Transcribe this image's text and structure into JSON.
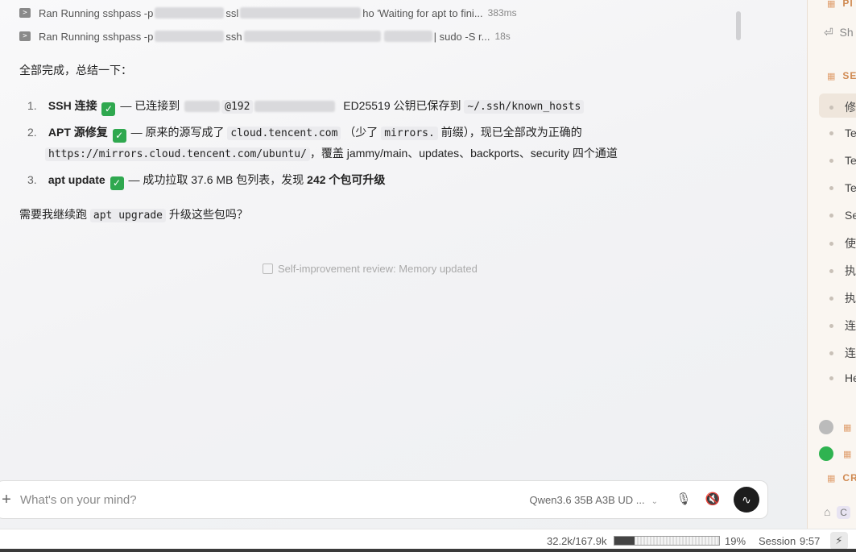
{
  "runs": [
    {
      "prefix": "Ran Running sshpass -p",
      "mid": "ssl",
      "tail": "ho 'Waiting for apt to fini...",
      "duration": "383ms"
    },
    {
      "prefix": "Ran Running sshpass -p",
      "mid": "ssh",
      "tail": "| sudo -S r...",
      "duration": "18s"
    }
  ],
  "summary_intro": "全部完成，总结一下：",
  "items": [
    {
      "num": "1.",
      "title": "SSH 连接",
      "text_a": "— 已连接到",
      "host_mid": "@192",
      "text_b": "ED25519 公钥已保存到",
      "code_a": "~/.ssh/known_hosts"
    },
    {
      "num": "2.",
      "title": "APT 源修复",
      "text_a": "— 原来的源写成了",
      "code_a": "cloud.tencent.com",
      "text_b": "（少了",
      "code_b": "mirrors.",
      "text_c": "前缀），现已全部改为正确的",
      "code_c": "https://mirrors.cloud.tencent.com/ubuntu/",
      "text_d": "，覆盖 jammy/main、updates、backports、security 四个通道"
    },
    {
      "num": "3.",
      "title": "apt update",
      "text_a": "— 成功拉取 37.6 MB 包列表，发现",
      "bold_b": "242 个包可升级"
    }
  ],
  "followup_a": "需要我继续跑",
  "followup_code": "apt upgrade",
  "followup_b": "升级这些包吗？",
  "notice": "Self-improvement review: Memory updated",
  "composer": {
    "placeholder": "What's on your mind?",
    "model": "Qwen3.6 35B A3B UD ..."
  },
  "sidebar": {
    "heads": [
      "PI",
      "SE",
      "CR"
    ],
    "first_sub": "Sh",
    "items": [
      "修",
      "Te",
      "Te",
      "Te",
      "Se",
      "使",
      "执",
      "执",
      "连",
      "连",
      "He"
    ],
    "bottom_tab": "C"
  },
  "status": {
    "tokens": "32.2k/167.9k",
    "percent": "19%",
    "context_fraction": 0.19,
    "session": "Session",
    "time": "9:57"
  },
  "colors": {
    "accent": "#d08a52",
    "check": "#2fa84f"
  }
}
